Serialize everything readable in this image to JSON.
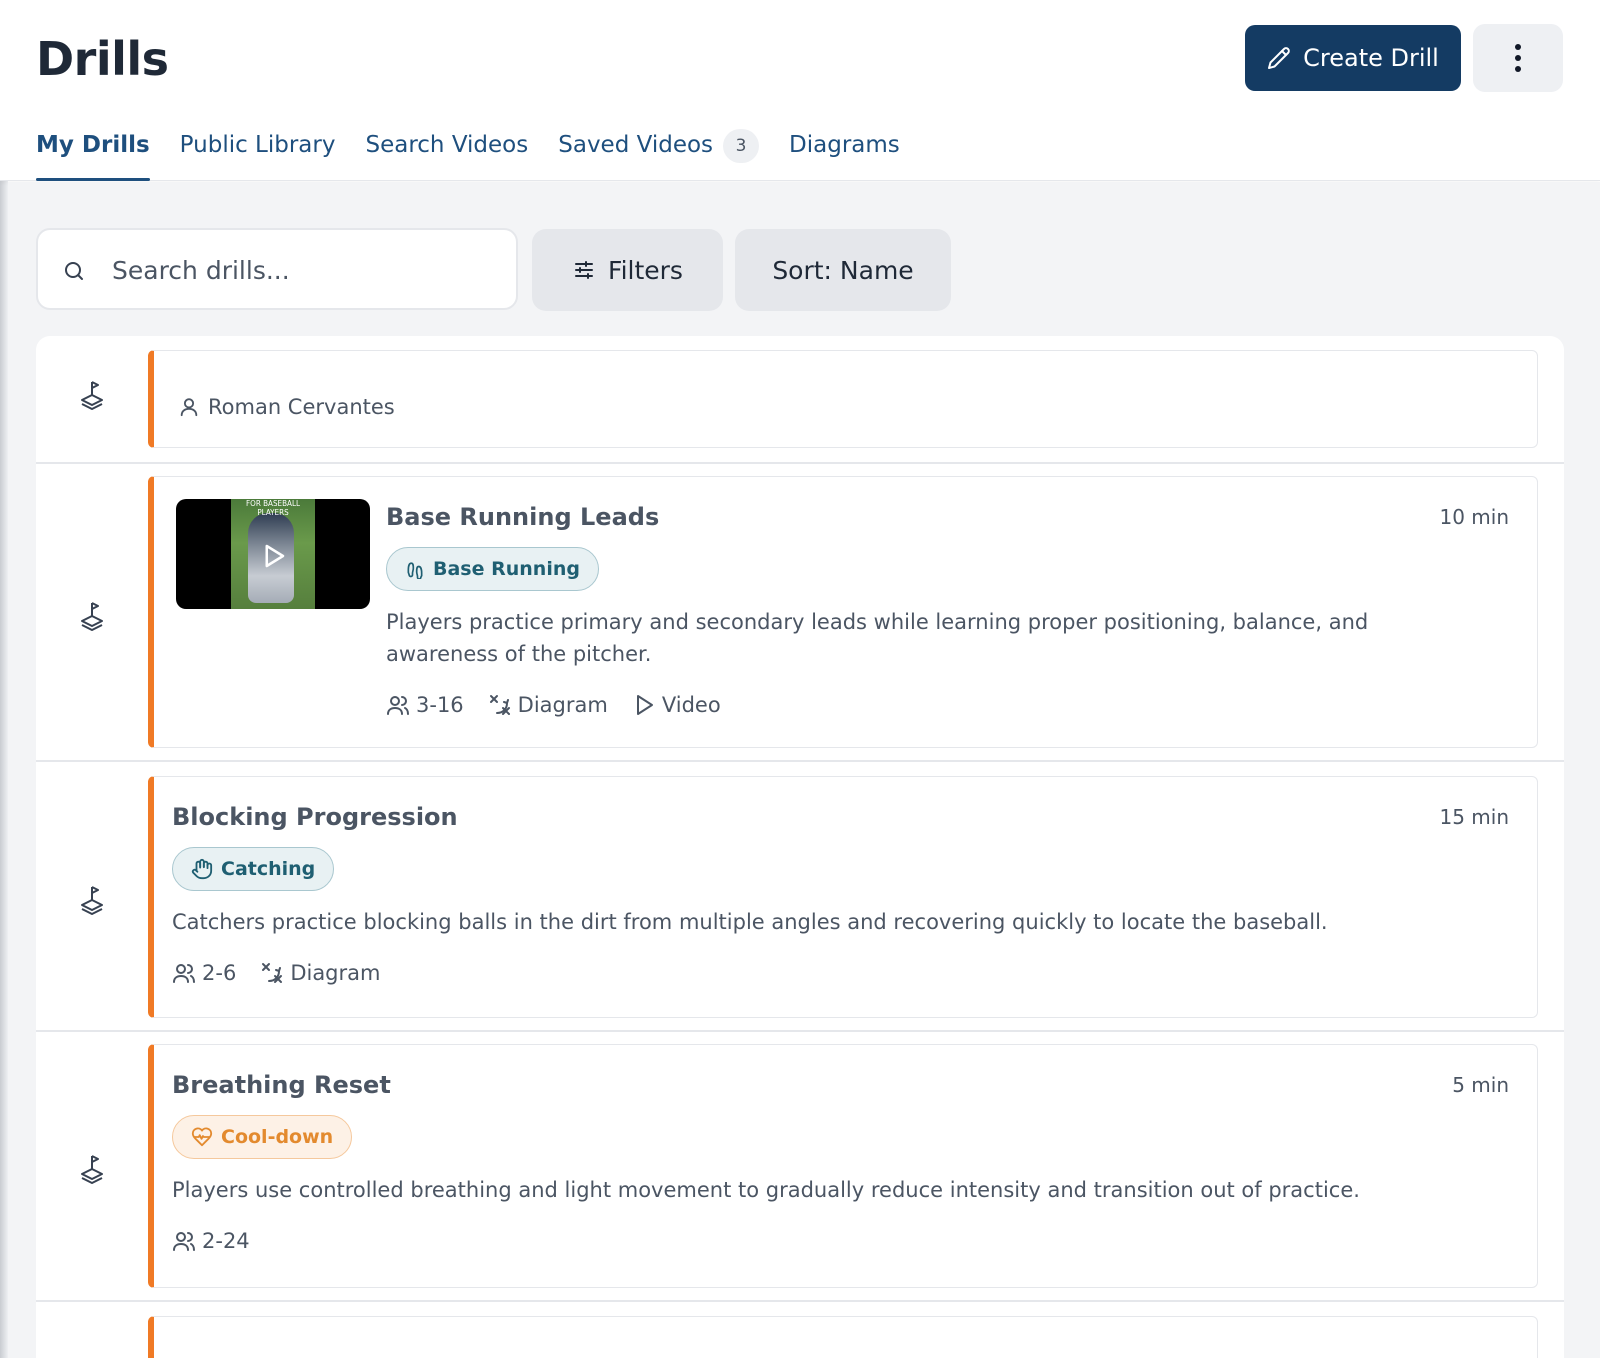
{
  "page": {
    "title": "Drills"
  },
  "header": {
    "create_label": "Create Drill"
  },
  "tabs": [
    {
      "label": "My Drills",
      "active": true
    },
    {
      "label": "Public Library"
    },
    {
      "label": "Search Videos"
    },
    {
      "label": "Saved Videos",
      "badge": "3"
    },
    {
      "label": "Diagrams"
    }
  ],
  "toolbar": {
    "search_placeholder": "Search drills...",
    "filters_label": "Filters",
    "sort_label": "Sort: Name"
  },
  "colors": {
    "primary": "#143b63",
    "accent": "#f07a25",
    "tab": "#1e4f7e"
  },
  "drills": [
    {
      "owner": "Roman Cervantes"
    },
    {
      "title": "Base Running Leads",
      "duration": "10 min",
      "tag": "Base Running",
      "tag_icon": "footprints-icon",
      "description": "Players practice primary and secondary leads while learning proper positioning, balance, and awareness of the pitcher.",
      "players": "3-16",
      "diagram_label": "Diagram",
      "video_label": "Video",
      "thumbnail_caption": "FOR BASEBALL PLAYERS"
    },
    {
      "title": "Blocking Progression",
      "duration": "15 min",
      "tag": "Catching",
      "tag_icon": "hand-icon",
      "description": "Catchers practice blocking balls in the dirt from multiple angles and recovering quickly to locate the baseball.",
      "players": "2-6",
      "diagram_label": "Diagram"
    },
    {
      "title": "Breathing Reset",
      "duration": "5 min",
      "tag": "Cool-down",
      "tag_icon": "heart-pulse-icon",
      "description": "Players use controlled breathing and light movement to gradually reduce intensity and transition out of practice.",
      "players": "2-24"
    }
  ]
}
